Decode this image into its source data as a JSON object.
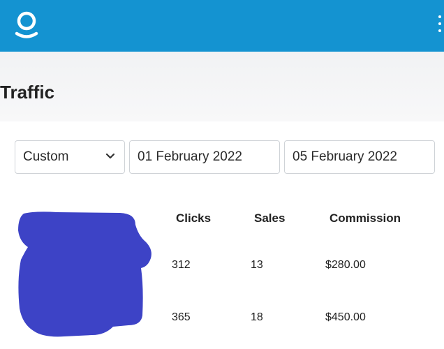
{
  "header": {
    "logo_icon": "circle-with-smile-logo-icon",
    "menu_icon": "vertical-dots-menu-icon",
    "bar_color": "#1493d1"
  },
  "page": {
    "title": "Traffic"
  },
  "filters": {
    "period": "Custom",
    "start_date": "01 February 2022",
    "end_date": "05 February 2022"
  },
  "stats": {
    "redaction_color": "#3d43c6",
    "columns": [
      "Clicks",
      "Sales",
      "Commission"
    ],
    "rows": [
      {
        "clicks": "312",
        "sales": "13",
        "commission": "$280.00"
      },
      {
        "clicks": "365",
        "sales": "18",
        "commission": "$450.00"
      }
    ]
  }
}
